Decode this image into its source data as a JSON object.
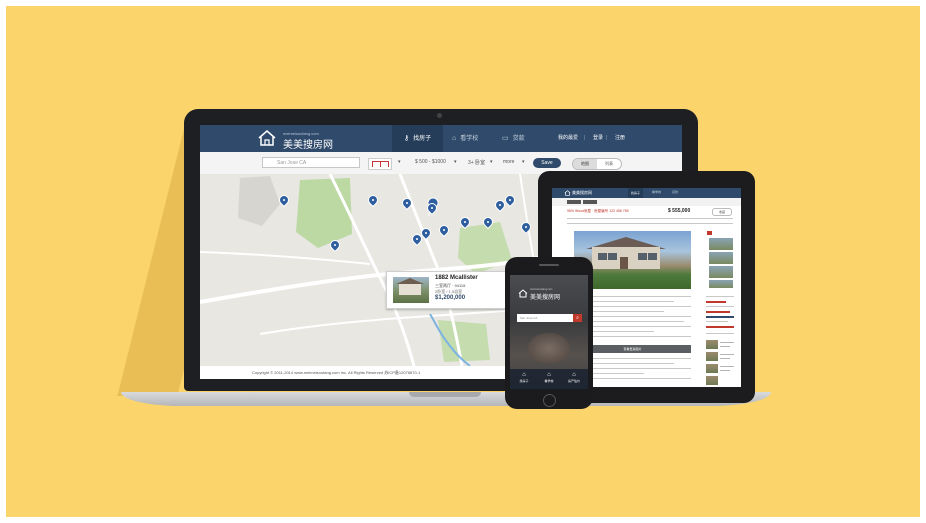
{
  "laptop": {
    "logo_small": "meimeisoufang.com",
    "logo_text": "美美搜房网",
    "nav": [
      {
        "label": "找房子",
        "icon": "key-icon"
      },
      {
        "label": "看学校",
        "icon": "school-icon"
      },
      {
        "label": "贷款",
        "icon": "monitor-icon"
      }
    ],
    "nav_right": [
      "我的最爱",
      "|",
      "登录",
      "|",
      "注册"
    ],
    "search_placeholder": "San Jose CA",
    "filters": [
      "$ 500 - $1000",
      "3+ 卧室",
      "more"
    ],
    "save_label": "Save",
    "toggle_on": "地图",
    "toggle_off": "列表",
    "popup": {
      "title": "1882 Mcallister",
      "line1": "三室两厅 · 94115",
      "line2": "2卧室 / 1.5浴室",
      "price": "$1,200,000"
    },
    "footer": "Copyright © 2011-2014 www.meimeisoufang.com Inc. All Rights Reserved    苏ICP备12076870-1"
  },
  "tablet": {
    "logo": "美美搜房网",
    "nav": [
      "找房子",
      "看学校",
      "贷款"
    ],
    "title": "96% Wood房屋 · 房屋编号 123 456 789",
    "price": "$ 555,000",
    "btn": "收藏",
    "grey_bar": "查看更多图片"
  },
  "phone": {
    "logo_small": "meimeisoufang.com",
    "logo": "美美搜房网",
    "search_placeholder": "San Jose CA",
    "search_btn": "⌕",
    "icons": [
      {
        "label": "找房子",
        "glyph": "⌂"
      },
      {
        "label": "看学校",
        "glyph": "⌂"
      },
      {
        "label": "房产估价",
        "glyph": "⌂"
      }
    ]
  }
}
